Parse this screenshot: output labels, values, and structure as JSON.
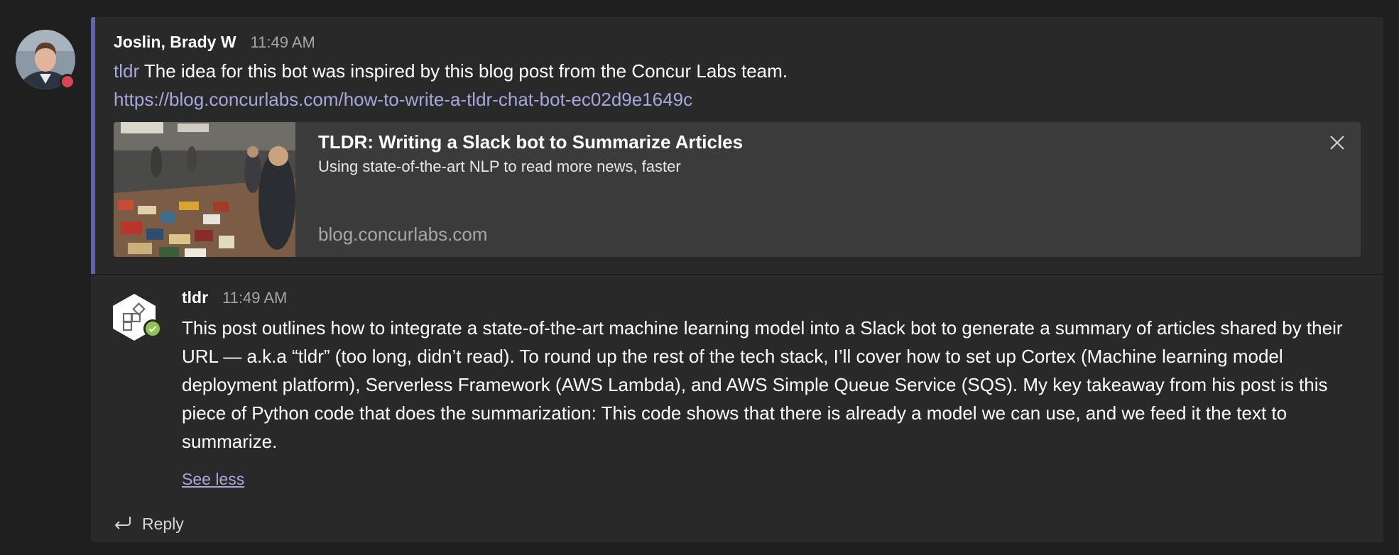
{
  "post": {
    "sender": "Joslin, Brady W",
    "time": "11:49 AM",
    "mention": "tldr",
    "text": " The idea for this bot was inspired by this blog post from the Concur Labs team.",
    "link": "https://blog.concurlabs.com/how-to-write-a-tldr-chat-bot-ec02d9e1649c"
  },
  "preview": {
    "title": "TLDR: Writing a Slack bot to Summarize Articles",
    "description": "Using state-of-the-art NLP to read more news, faster",
    "domain": "blog.concurlabs.com",
    "close_icon": "close-icon",
    "thumbnail": "book-market-photo"
  },
  "reply": {
    "sender": "tldr",
    "time": "11:49 AM",
    "body": "This post outlines how to integrate a state-of-the-art machine learning model into a Slack bot to generate a summary of articles shared by their URL — a.k.a “tldr” (too long, didn’t read). To round up the rest of the tech stack, I’ll cover how to set up Cortex (Machine learning model deployment platform), Serverless Framework (AWS Lambda), and AWS Simple Queue Service (SQS). My key takeaway from his post is this piece of Python code that does the summarization: This code shows that there is already a model we can use, and we feed it the text to summarize.",
    "see_less": "See less",
    "bot_icon": "bot-app-icon"
  },
  "actions": {
    "reply_label": "Reply",
    "reply_icon": "reply-arrow-icon"
  },
  "colors": {
    "background": "#1f1f1f",
    "card": "#292929",
    "accent": "#6264a7",
    "link": "#a6a7dc",
    "presence_busy": "#d74654",
    "bot_badge": "#92c353"
  }
}
